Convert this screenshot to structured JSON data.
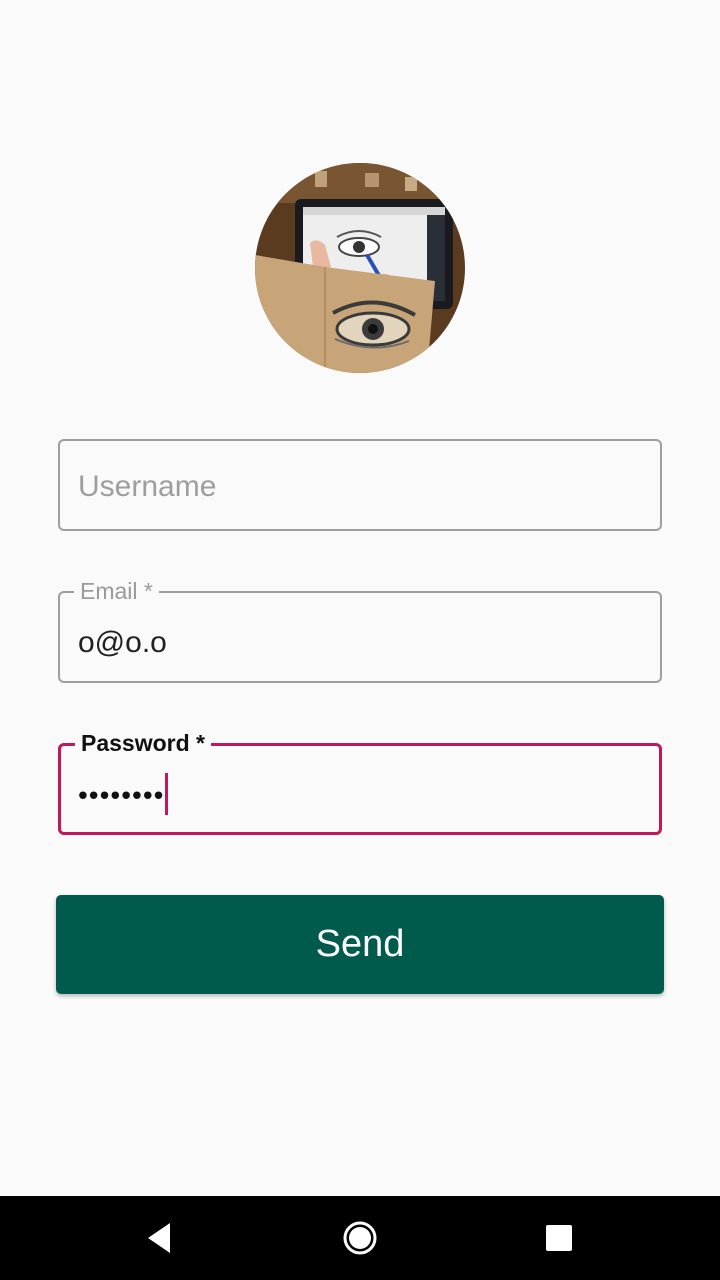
{
  "profile": {
    "avatar_icon": "avatar-photo-eye-drawing"
  },
  "form": {
    "username": {
      "placeholder": "Username",
      "value": ""
    },
    "email": {
      "label": "Email *",
      "value": "o@o.o"
    },
    "password": {
      "label": "Password *",
      "value": "••••••••",
      "focused": true
    },
    "send_label": "Send"
  },
  "colors": {
    "background": "#fafafa",
    "field_border": "#9e9e9e",
    "focus_accent": "#c2185b",
    "button_background": "#005b4d",
    "button_text": "#ffffff",
    "nav_bar": "#000000"
  },
  "navigation": {
    "back_icon": "back-triangle-icon",
    "home_icon": "home-circle-icon",
    "recents_icon": "recents-square-icon"
  }
}
